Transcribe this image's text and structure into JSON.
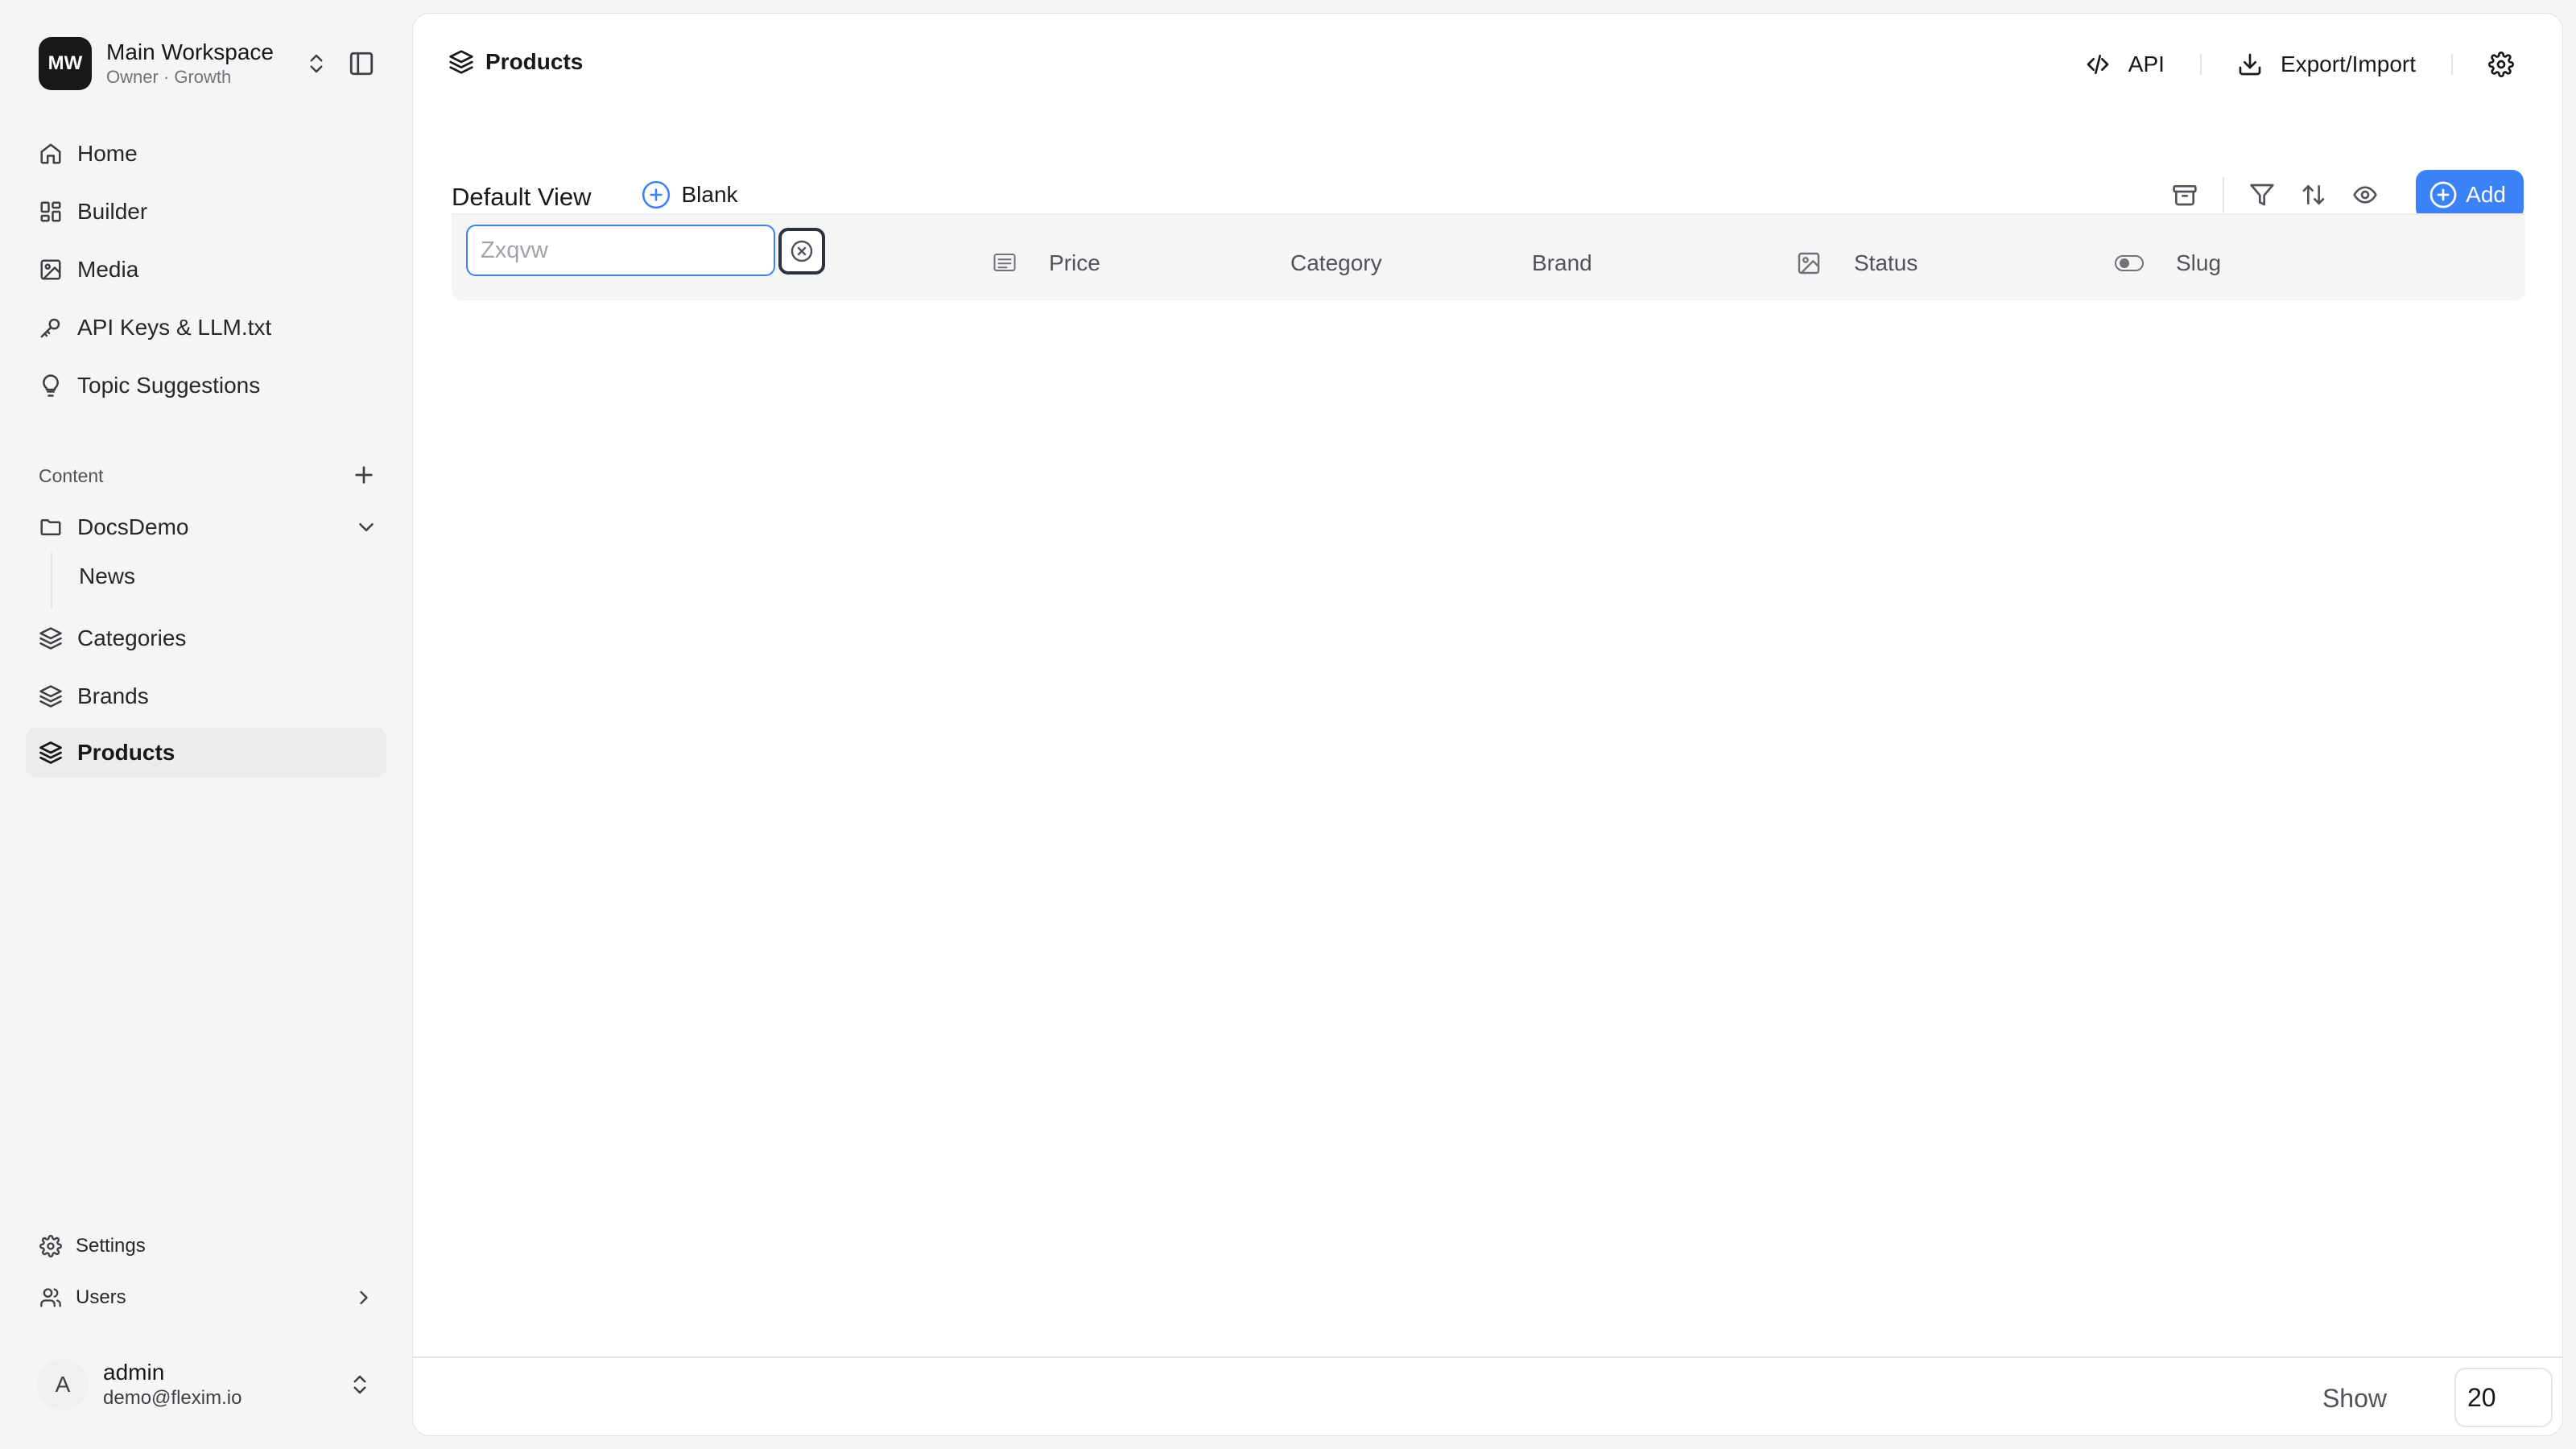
{
  "workspace": {
    "initials": "MW",
    "name": "Main Workspace",
    "subtitle": "Owner · Growth"
  },
  "nav": {
    "home": "Home",
    "builder": "Builder",
    "media": "Media",
    "api_keys": "API Keys & LLM.txt",
    "topic_suggestions": "Topic Suggestions"
  },
  "content": {
    "section_label": "Content",
    "folder": "DocsDemo",
    "folder_child": "News",
    "collections": [
      "Categories",
      "Brands",
      "Products"
    ],
    "active": "Products"
  },
  "bottom_nav": {
    "settings": "Settings",
    "users": "Users"
  },
  "user": {
    "initial": "A",
    "name": "admin",
    "email": "demo@flexim.io"
  },
  "header": {
    "title": "Products",
    "api_label": "API",
    "export_label": "Export/Import"
  },
  "views": {
    "default_tab": "Default View",
    "blank_tab": "Blank"
  },
  "toolbar": {
    "add_label": "Add"
  },
  "table": {
    "search_value": "Zxqvw",
    "columns": [
      "Price",
      "Category",
      "Brand",
      "Status",
      "Slug"
    ]
  },
  "pagination": {
    "show_label": "Show",
    "page_size": "20"
  },
  "colors": {
    "accent": "#3b82f6",
    "active_bg": "#ececed"
  }
}
